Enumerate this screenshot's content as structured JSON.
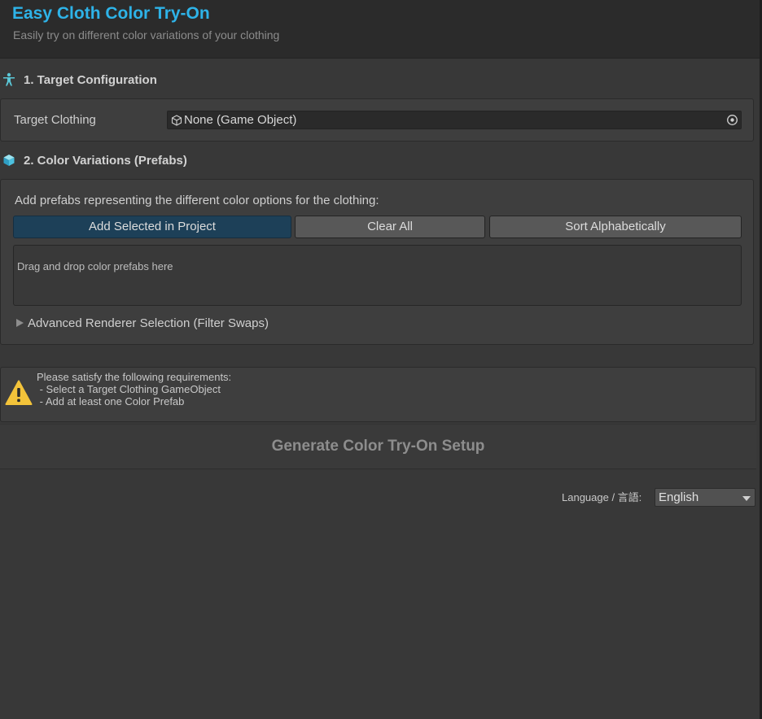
{
  "header": {
    "title": "Easy Cloth Color Try-On",
    "subtitle": "Easily try on different color variations of your clothing"
  },
  "target_section": {
    "title": "1. Target Configuration",
    "icon": "humanoid-icon",
    "field_label": "Target Clothing",
    "field_value": "None (Game Object)"
  },
  "color_section": {
    "title": "2. Color Variations (Prefabs)",
    "icon": "cube-icon",
    "description": "Add prefabs representing the different color options for the clothing:",
    "buttons": {
      "add_selected": "Add Selected in Project",
      "clear_all": "Clear All",
      "sort": "Sort Alphabetically"
    },
    "dropzone_text": "Drag and drop color prefabs here",
    "foldout_label": "Advanced Renderer Selection (Filter Swaps)"
  },
  "warning": {
    "icon": "warning-icon",
    "heading": "Please satisfy the following requirements:",
    "items": [
      " - Select a Target Clothing GameObject",
      " - Add at least one Color Prefab"
    ]
  },
  "generate_button": "Generate Color Try-On Setup",
  "language": {
    "label": "Language / 言語:",
    "selected": "English"
  },
  "colors": {
    "title": "#2eb3e8",
    "primary_button": "#1d4058",
    "warning": "#f3c33a",
    "icon_accent": "#5bc8d8"
  }
}
